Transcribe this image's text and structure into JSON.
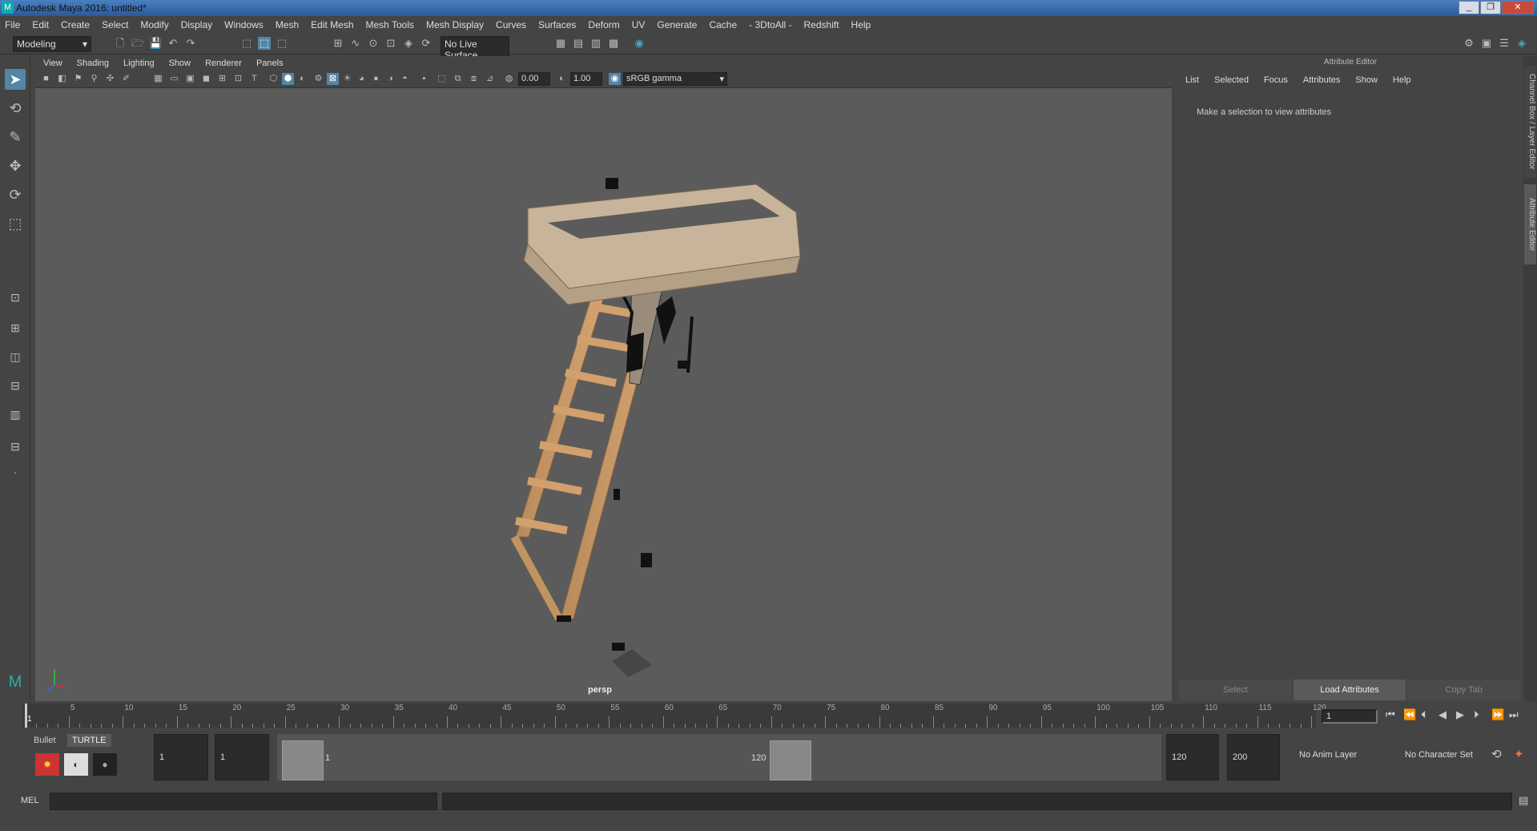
{
  "window": {
    "title": "Autodesk Maya 2016: untitled*",
    "minimize": "_",
    "maximize": "❐",
    "close": "✕"
  },
  "menubar": [
    "File",
    "Edit",
    "Create",
    "Select",
    "Modify",
    "Display",
    "Windows",
    "Mesh",
    "Edit Mesh",
    "Mesh Tools",
    "Mesh Display",
    "Curves",
    "Surfaces",
    "Deform",
    "UV",
    "Generate",
    "Cache",
    "- 3DtoAll -",
    "Redshift",
    "Help"
  ],
  "toolbar": {
    "mode": "Modeling",
    "live_surface": "No Live Surface"
  },
  "viewport": {
    "menu": [
      "View",
      "Shading",
      "Lighting",
      "Show",
      "Renderer",
      "Panels"
    ],
    "exposure": "0.00",
    "gamma": "1.00",
    "colorspace": "sRGB gamma",
    "camera_label": "persp"
  },
  "attribute_editor": {
    "title": "Attribute Editor",
    "menu": [
      "List",
      "Selected",
      "Focus",
      "Attributes",
      "Show",
      "Help"
    ],
    "message": "Make a selection to view attributes",
    "buttons": {
      "select": "Select",
      "load": "Load Attributes",
      "copy": "Copy Tab"
    }
  },
  "side_tabs": {
    "channel": "Channel Box / Layer Editor",
    "attr": "Attribute Editor"
  },
  "timeline": {
    "ticks": [
      "1",
      "5",
      "10",
      "15",
      "20",
      "25",
      "30",
      "35",
      "40",
      "45",
      "50",
      "55",
      "60",
      "65",
      "70",
      "75",
      "80",
      "85",
      "90",
      "95",
      "100",
      "105",
      "110",
      "115",
      "120"
    ],
    "current_frame": "1"
  },
  "range": {
    "shelf_tabs": [
      "Bullet",
      "TURTLE"
    ],
    "start": "1",
    "playback_start": "1",
    "slider_start": "1",
    "slider_end": "120",
    "playback_end": "120",
    "end": "200",
    "anim_layer": "No Anim Layer",
    "char_set": "No Character Set"
  },
  "cmdline": {
    "label": "MEL"
  }
}
